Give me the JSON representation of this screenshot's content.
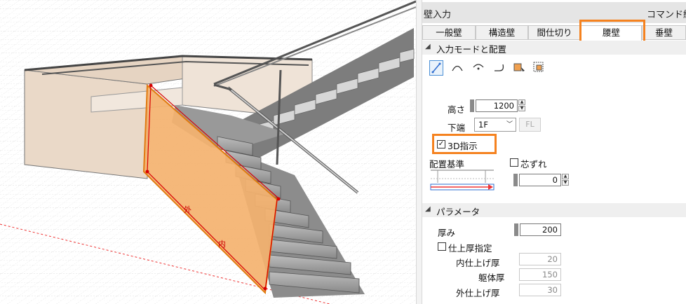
{
  "viewport": {
    "wall_label_outer": "外",
    "wall_label_inner": "内"
  },
  "panel": {
    "title": "壁入力",
    "title_right": "コマンド終了",
    "tabs": [
      "一般壁",
      "構造壁",
      "間仕切り",
      "腰壁",
      "垂壁"
    ],
    "active_tab": "腰壁",
    "section1": {
      "label": "入力モードと配置"
    },
    "mode_icons": [
      "line-mode-icon",
      "arc-mode-icon",
      "arc3-mode-icon",
      "arc-curve-mode-icon",
      "box-select-icon",
      "rect-select-icon"
    ],
    "height_label": "高さ",
    "height_value": "1200",
    "bottom_label": "下端",
    "bottom_value": "1F",
    "fl_button": "FL",
    "d3_label": "3D指示",
    "d3_checked": true,
    "placement_label": "配置基準",
    "offset_label": "芯ずれ",
    "offset_checked": false,
    "offset_value": "0",
    "section2": {
      "label": "パラメータ"
    },
    "thickness_label": "厚み",
    "thickness_value": "200",
    "finish_label": "仕上厚指定",
    "finish_checked": false,
    "inner_label": "内仕上げ厚",
    "inner_value": "20",
    "body_label": "躯体厚",
    "body_value": "150",
    "outer_label": "外仕上げ厚",
    "outer_value": "30"
  },
  "colors": {
    "highlight": "#f5821f",
    "wall_fill": "#f4b26f",
    "wall_edge": "#d80000",
    "parapet": "#ead9c8"
  }
}
